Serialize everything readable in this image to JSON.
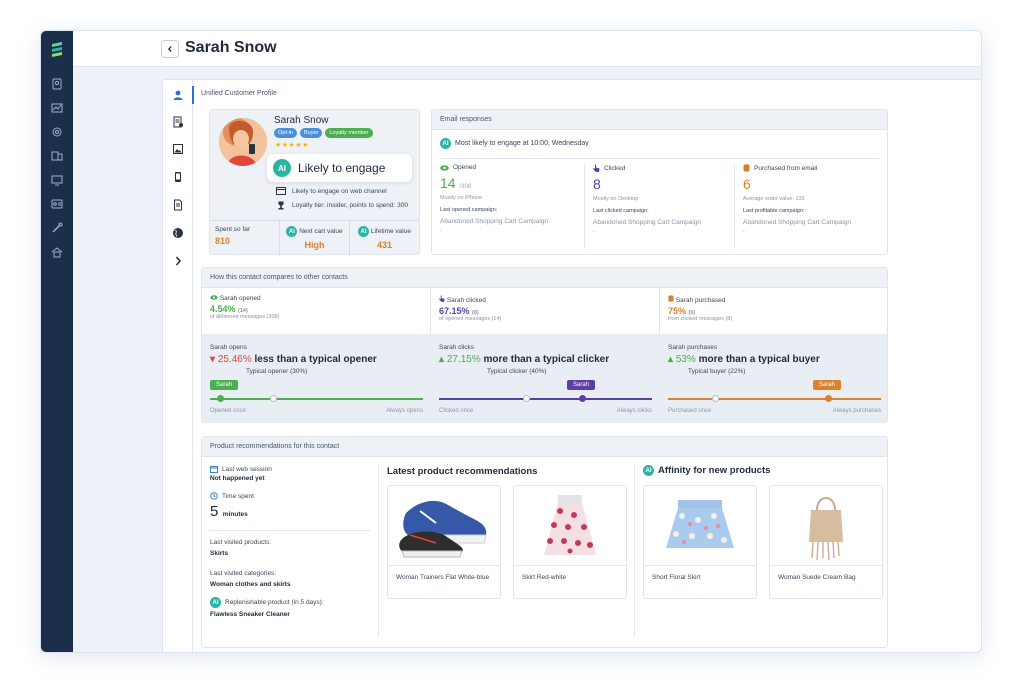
{
  "header": {
    "title": "Sarah Snow"
  },
  "rail": {
    "icons": [
      "logo-icon",
      "contacts-icon",
      "analytics-icon",
      "settings-icon",
      "campaigns-icon",
      "automation-icon",
      "audience-icon",
      "tools-icon",
      "home-icon"
    ]
  },
  "tabs": [
    "profile-icon",
    "details-icon",
    "image-icon",
    "mobile-icon",
    "document-icon",
    "globe-icon",
    "chevron-right-icon"
  ],
  "section_title": "Unified Customer Profile",
  "profile": {
    "name": "Sarah Snow",
    "badges": [
      {
        "label": "Opt-in",
        "color": "#4a90d9"
      },
      {
        "label": "Buyer",
        "color": "#4a90d9"
      },
      {
        "label": "Loyalty member",
        "color": "#4cae4f"
      }
    ],
    "stars": "★★★★★",
    "likely_label": "Likely to engage",
    "ai_label": "AI",
    "web_channel": "Likely to engage on web channel",
    "loyalty": "Loyalty tier: insider, points to spend: 300",
    "stats": [
      {
        "label": "Spent so far",
        "value": "810"
      },
      {
        "label": "Next cart value",
        "value": "High"
      },
      {
        "label": "Lifetime value",
        "value": "431"
      }
    ]
  },
  "email": {
    "title": "Email responses",
    "most_likely": "Most likely to engage at 10:00, Wednesday",
    "columns": [
      {
        "label": "Opened",
        "value": "14",
        "sub": "/308",
        "note": "Mostly on iPhone",
        "campaign_label": "Last opened campaign:",
        "campaign": "Abandoned Shopping Cart Campaign",
        "dash": "-",
        "color": "#4cae4f"
      },
      {
        "label": "Clicked",
        "value": "8",
        "sub": "",
        "note": "Mostly on Desktop",
        "campaign_label": "Last clicked campaign:",
        "campaign": "Abandoned Shopping Cart Campaign",
        "dash": "-",
        "color": "#5b3fa6"
      },
      {
        "label": "Purchased from email",
        "value": "6",
        "sub": "",
        "note": "Average order value: 135",
        "campaign_label": "Last profitable campaign:",
        "campaign": "Abandoned Shopping Cart Campaign",
        "dash": "-",
        "color": "#d9822b"
      }
    ]
  },
  "compare": {
    "title": "How this contact compares to other contacts",
    "rates": [
      {
        "label": "Sarah opened",
        "pct": "4.54%",
        "count": "(14)",
        "of": "of delivered messages (308)",
        "color": "#4cae4f"
      },
      {
        "label": "Sarah clicked",
        "pct": "67.15%",
        "count": "(8)",
        "of": "of opened messages (14)",
        "color": "#5b3fa6"
      },
      {
        "label": "Sarah purchased",
        "pct": "75%",
        "count": "(6)",
        "of": "from clicked messages (8)",
        "color": "#d9822b"
      }
    ],
    "bands": [
      {
        "title": "Sarah opens",
        "pct": "25.46%",
        "dir": "down",
        "text": "less than a typical opener",
        "typical": "Typical opener (30%)",
        "sarah_tag": "Sarah",
        "left": "Opened once",
        "right": "Always opens",
        "color": "#4cae4f",
        "sarah_pos": 0.03,
        "typical_pos": 0.3
      },
      {
        "title": "Sarah clicks",
        "pct": "27.15%",
        "dir": "up",
        "text": "more than a typical clicker",
        "typical": "Typical clicker (40%)",
        "sarah_tag": "Sarah",
        "left": "Clicked once",
        "right": "Always clicks",
        "color": "#5b3fa6",
        "sarah_pos": 0.67,
        "typical_pos": 0.4
      },
      {
        "title": "Sarah purchases",
        "pct": "53%",
        "dir": "up",
        "text": "more than a typical buyer",
        "typical": "Typical buyer (22%)",
        "sarah_tag": "Sarah",
        "left": "Purchased once",
        "right": "Always purchases",
        "color": "#d9822b",
        "sarah_pos": 0.75,
        "typical_pos": 0.22
      }
    ]
  },
  "recs": {
    "title": "Product recommendations for this contact",
    "last_session_label": "Last web session",
    "last_session_value": "Not happened yet",
    "time_spent_label": "Time spent",
    "time_spent_value": "5",
    "time_spent_unit": "minutes",
    "visited_products_label": "Last visited products:",
    "visited_products_value": "Skirts",
    "visited_categories_label": "Last visited categories:",
    "visited_categories_value": "Woman clothes and skirts",
    "replenish_label": "Replenishable product (in 5 days):",
    "replenish_value": "Flawless Sneaker Cleaner",
    "latest_title": "Latest product recommendations",
    "affinity_title": "Affinity for new products",
    "products": [
      {
        "name": "Woman Trainers Flat White-blue"
      },
      {
        "name": "Skirt Red-white"
      },
      {
        "name": "Short Floral Skirt"
      },
      {
        "name": "Woman Suede Cream Bag"
      }
    ]
  }
}
